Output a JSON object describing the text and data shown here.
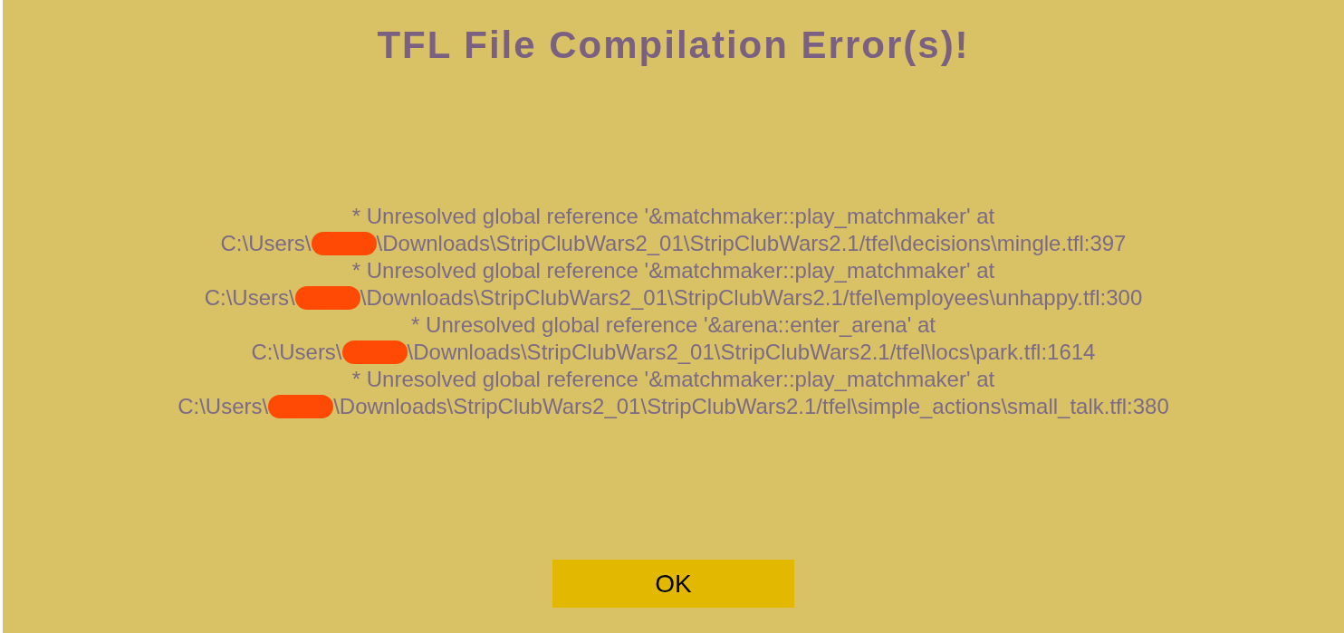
{
  "title": "TFL File Compilation Error(s)!",
  "errors": [
    {
      "message": "* Unresolved global reference '&matchmaker::play_matchmaker' at",
      "path_before": "C:\\Users\\",
      "path_after": "\\Downloads\\StripClubWars2_01\\StripClubWars2.1/tfel\\decisions\\mingle.tfl:397"
    },
    {
      "message": "* Unresolved global reference '&matchmaker::play_matchmaker' at",
      "path_before": "C:\\Users\\",
      "path_after": "\\Downloads\\StripClubWars2_01\\StripClubWars2.1/tfel\\employees\\unhappy.tfl:300"
    },
    {
      "message": "* Unresolved global reference '&arena::enter_arena' at",
      "path_before": "C:\\Users\\",
      "path_after": "\\Downloads\\StripClubWars2_01\\StripClubWars2.1/tfel\\locs\\park.tfl:1614"
    },
    {
      "message": "* Unresolved global reference '&matchmaker::play_matchmaker' at",
      "path_before": "C:\\Users\\",
      "path_after": "\\Downloads\\StripClubWars2_01\\StripClubWars2.1/tfel\\simple_actions\\small_talk.tfl:380"
    }
  ],
  "button": "OK"
}
